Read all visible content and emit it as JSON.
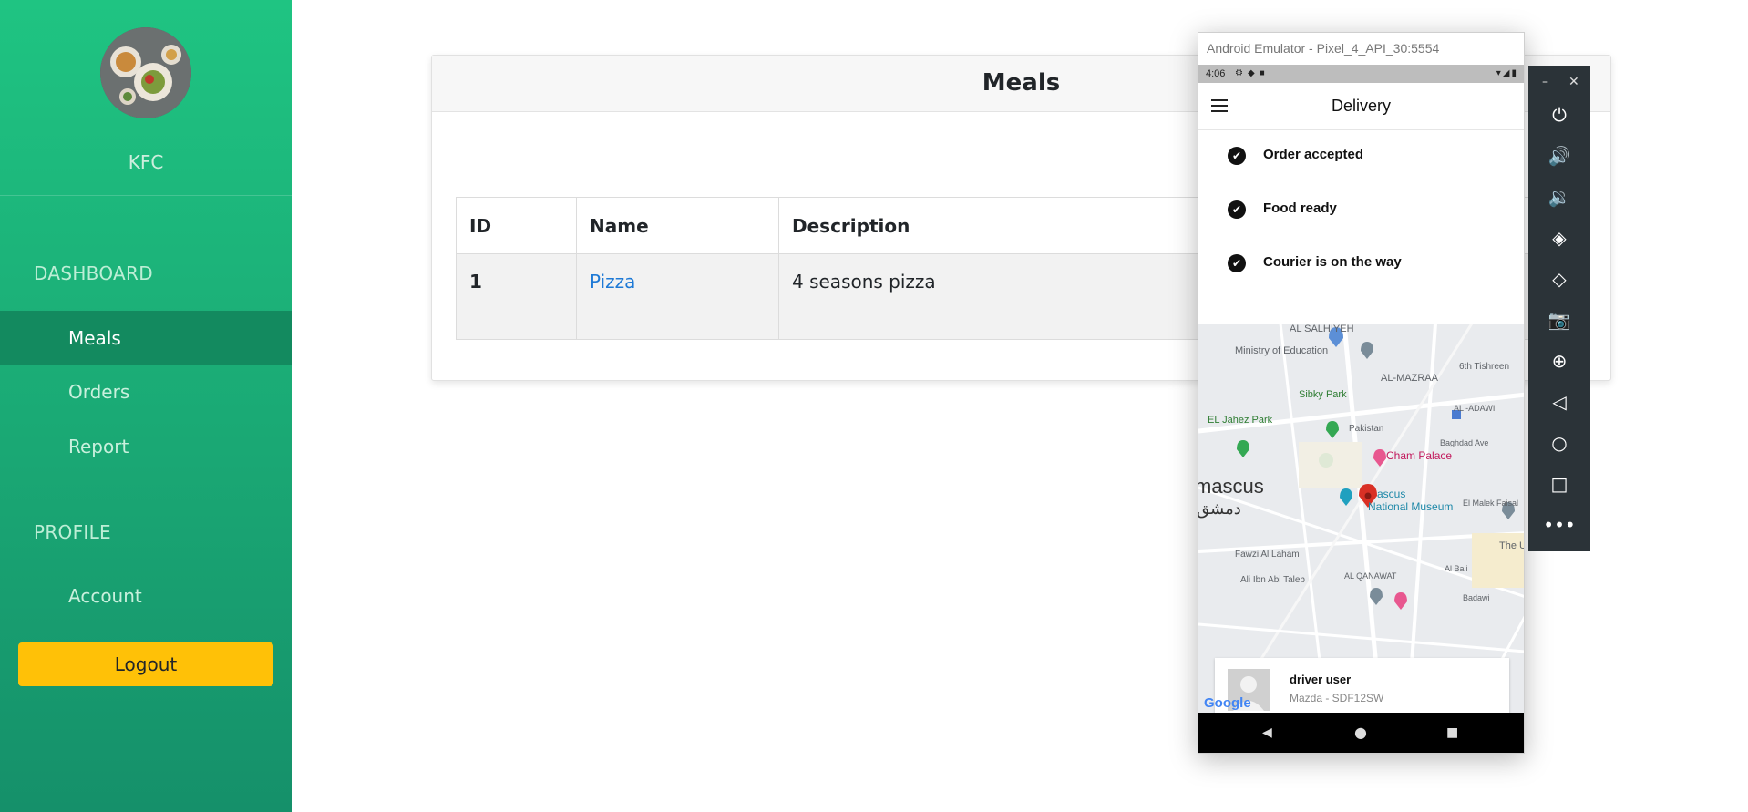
{
  "sidebar": {
    "brand": "KFC",
    "dashboard_heading": "DASHBOARD",
    "items": [
      {
        "label": "Meals"
      },
      {
        "label": "Orders"
      },
      {
        "label": "Report"
      }
    ],
    "profile_heading": "PROFILE",
    "profile_items": [
      {
        "label": "Account"
      }
    ],
    "logout_label": "Logout",
    "colors": {
      "gradient_top": "#1fc482",
      "active_item": "#138a5f",
      "logout": "#ffc107"
    }
  },
  "card": {
    "title": "Meals",
    "table": {
      "headers": [
        "ID",
        "Name",
        "Description"
      ],
      "rows": [
        {
          "id": "1",
          "name": "Pizza",
          "description": "4 seasons pizza"
        }
      ]
    }
  },
  "emulator": {
    "window_title": "Android Emulator - Pixel_4_API_30:5554",
    "status_time": "4:06",
    "app_title": "Delivery",
    "steps": [
      {
        "label": "Order accepted"
      },
      {
        "label": "Food ready"
      },
      {
        "label": "Courier is on the way"
      }
    ],
    "map_labels": {
      "al_salhiyeh": "AL SALHIYEH",
      "ministry": "Ministry of Education",
      "sibky": "Sibky Park",
      "mazraa": "AL-MAZRAA",
      "tishreen": "6th Tishreen",
      "jahez": "EL Jahez Park",
      "adawi": "AL -ADAWI",
      "pakistan": "Pakistan",
      "baghdad": "Baghdad Ave",
      "cham": "Cham Palace",
      "city": "mascus",
      "city_ar": "دمشق",
      "museum_1": "ascus",
      "museum_2": "National Museum",
      "malek": "El Malek Faisal",
      "fawzi": "Fawzi Al Laham",
      "ali": "Ali Ibn Abi Taleb",
      "qanawat": "AL QANAWAT",
      "umayyad": "The Ur",
      "badawi": "Badawi",
      "al_bali": "Al Bali"
    },
    "driver": {
      "name": "driver user",
      "car": "Mazda - SDF12SW"
    },
    "google_label": "Google",
    "icons": [
      "power-icon",
      "volume-up-icon",
      "volume-down-icon",
      "rotate-left-icon",
      "rotate-right-icon",
      "camera-icon",
      "zoom-icon",
      "back-icon",
      "home-icon",
      "overview-icon",
      "more-icon"
    ]
  }
}
